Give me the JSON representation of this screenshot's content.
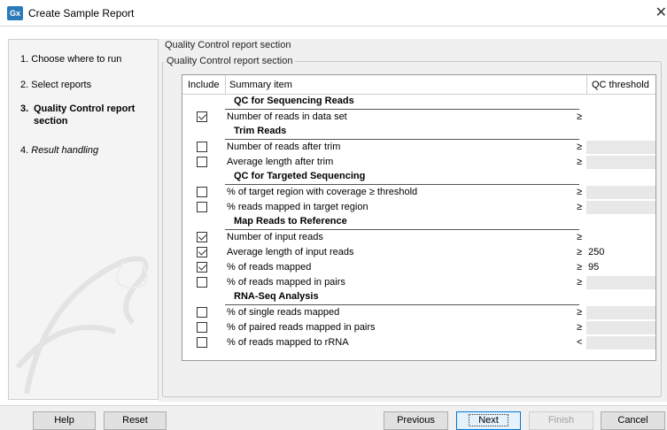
{
  "window": {
    "app_icon": "Gx",
    "title": "Create Sample Report",
    "close": "✕"
  },
  "steps": [
    {
      "number": "1.",
      "label": "Choose where to run"
    },
    {
      "number": "2.",
      "label": "Select reports"
    },
    {
      "number": "3.",
      "label": "Quality Control report section"
    },
    {
      "number": "4.",
      "label": "Result handling"
    }
  ],
  "section": {
    "title": "Quality Control report section",
    "legend": "Quality Control report section"
  },
  "table": {
    "headers": {
      "include": "Include",
      "summary": "Summary item",
      "threshold": "QC threshold"
    },
    "groups": [
      {
        "title": "QC for Sequencing Reads",
        "rows": [
          {
            "label": "Number of reads in data set",
            "checked": true,
            "op": "≥",
            "value": "",
            "disabled": false
          }
        ]
      },
      {
        "title": "Trim Reads",
        "rows": [
          {
            "label": "Number of reads after trim",
            "checked": false,
            "op": "≥",
            "value": "",
            "disabled": true
          },
          {
            "label": "Average length after trim",
            "checked": false,
            "op": "≥",
            "value": "",
            "disabled": true
          }
        ]
      },
      {
        "title": "QC for Targeted Sequencing",
        "rows": [
          {
            "label": "% of target region with coverage ≥ threshold",
            "checked": false,
            "op": "≥",
            "value": "",
            "disabled": true
          },
          {
            "label": "% reads mapped in target region",
            "checked": false,
            "op": "≥",
            "value": "",
            "disabled": true
          }
        ]
      },
      {
        "title": "Map Reads to Reference",
        "rows": [
          {
            "label": "Number of input reads",
            "checked": true,
            "op": "≥",
            "value": "",
            "disabled": false
          },
          {
            "label": "Average length of input reads",
            "checked": true,
            "op": "≥",
            "value": "250",
            "disabled": false
          },
          {
            "label": "% of reads mapped",
            "checked": true,
            "op": "≥",
            "value": "95",
            "disabled": false
          },
          {
            "label": "% of reads mapped in pairs",
            "checked": false,
            "op": "≥",
            "value": "",
            "disabled": true
          }
        ]
      },
      {
        "title": "RNA-Seq Analysis",
        "rows": [
          {
            "label": "% of single reads mapped",
            "checked": false,
            "op": "≥",
            "value": "",
            "disabled": true
          },
          {
            "label": "% of paired reads mapped in pairs",
            "checked": false,
            "op": "≥",
            "value": "",
            "disabled": true
          },
          {
            "label": "% of reads mapped to rRNA",
            "checked": false,
            "op": "<",
            "value": "",
            "disabled": true
          }
        ]
      }
    ]
  },
  "footer": {
    "help": "Help",
    "reset": "Reset",
    "previous": "Previous",
    "next": "Next",
    "finish": "Finish",
    "cancel": "Cancel"
  },
  "colors": {
    "accent": "#0078d7",
    "app_icon": "#2a7ab8"
  }
}
